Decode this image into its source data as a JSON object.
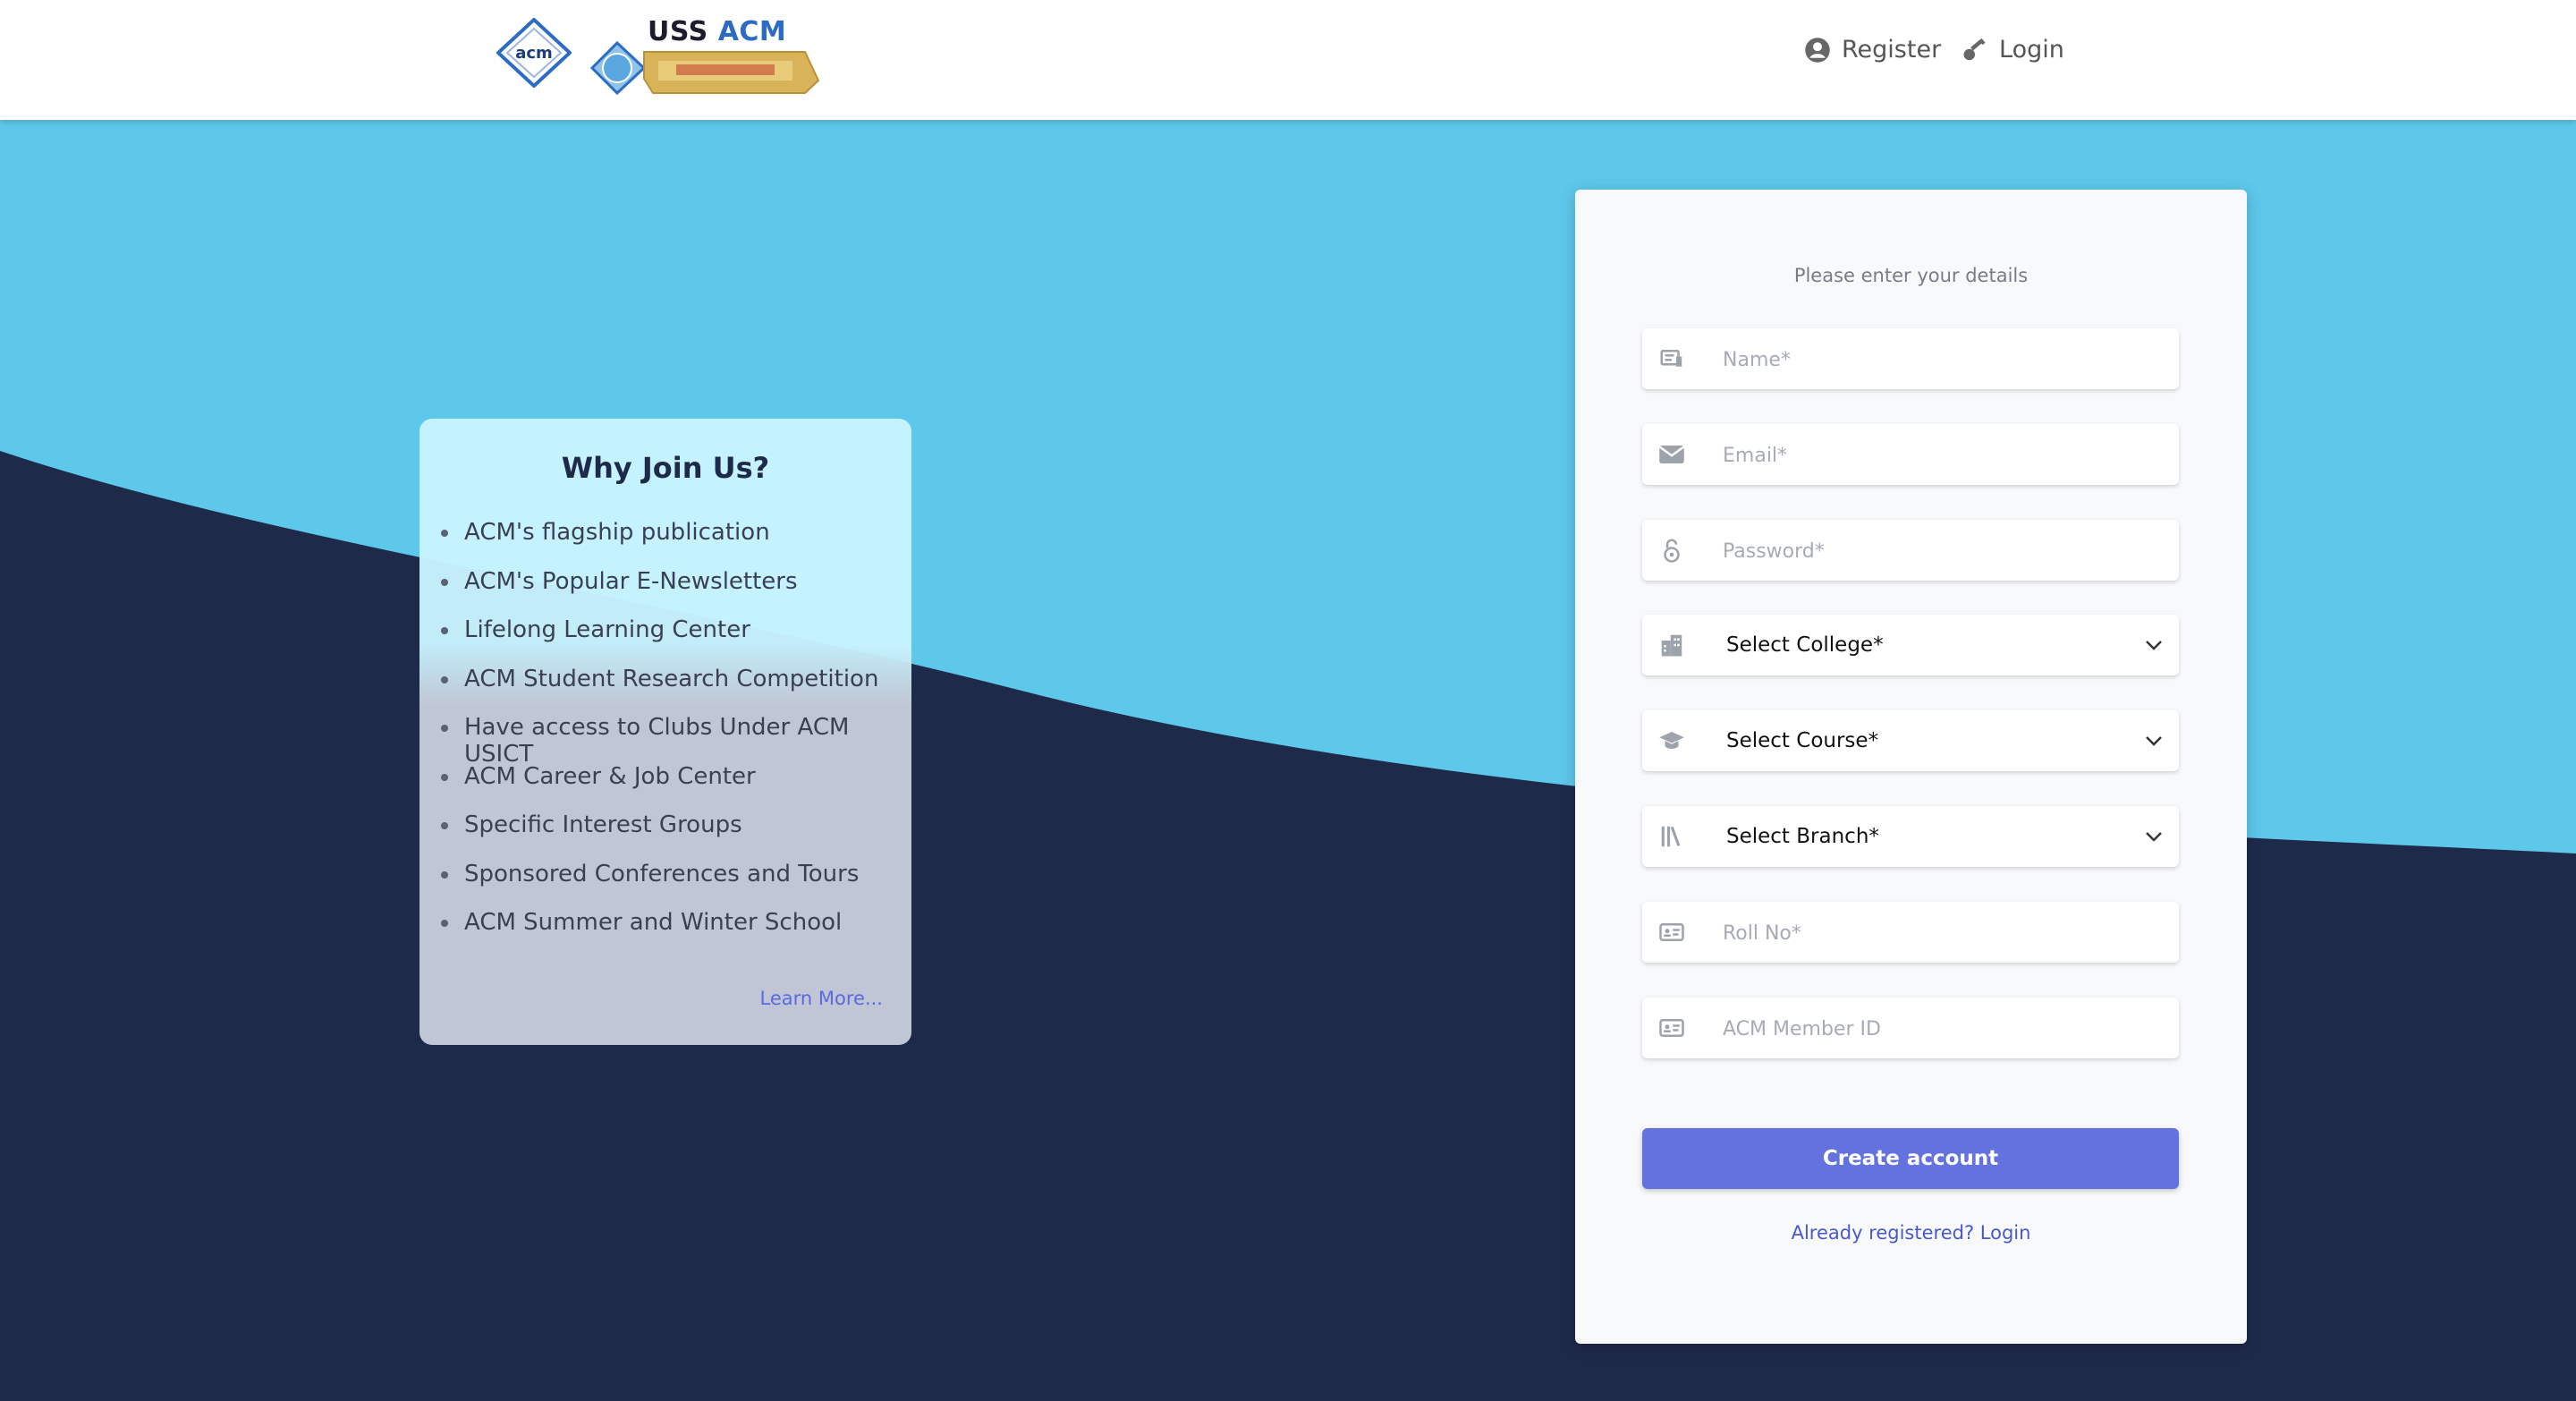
{
  "header": {
    "logo_text": "USS",
    "logo_text_accent": "ACM",
    "nav": [
      {
        "label": "Register",
        "icon": "user-circle-icon"
      },
      {
        "label": "Login",
        "icon": "key-icon"
      }
    ]
  },
  "why_join": {
    "title": "Why Join Us?",
    "items": [
      "ACM's flagship publication",
      "ACM's Popular E-Newsletters",
      "Lifelong Learning Center",
      "ACM Student Research Competition",
      "Have access to Clubs Under ACM USICT",
      "ACM Career & Job Center",
      "Specific Interest Groups",
      "Sponsored Conferences and Tours",
      "ACM Summer and Winter School"
    ],
    "learn_more": "Learn More..."
  },
  "form": {
    "subtitle": "Please enter your details",
    "name_placeholder": "Name*",
    "email_placeholder": "Email*",
    "password_placeholder": "Password*",
    "college_label": "Select College*",
    "course_label": "Select Course*",
    "branch_label": "Select Branch*",
    "rollno_placeholder": "Roll No*",
    "memberid_placeholder": "ACM Member ID",
    "submit_label": "Create account",
    "already_registered": "Already registered? Login"
  },
  "colors": {
    "sky": "#5ec8ea",
    "navy": "#1e2a4a",
    "accent": "#6472df",
    "link": "#4a58cf"
  }
}
